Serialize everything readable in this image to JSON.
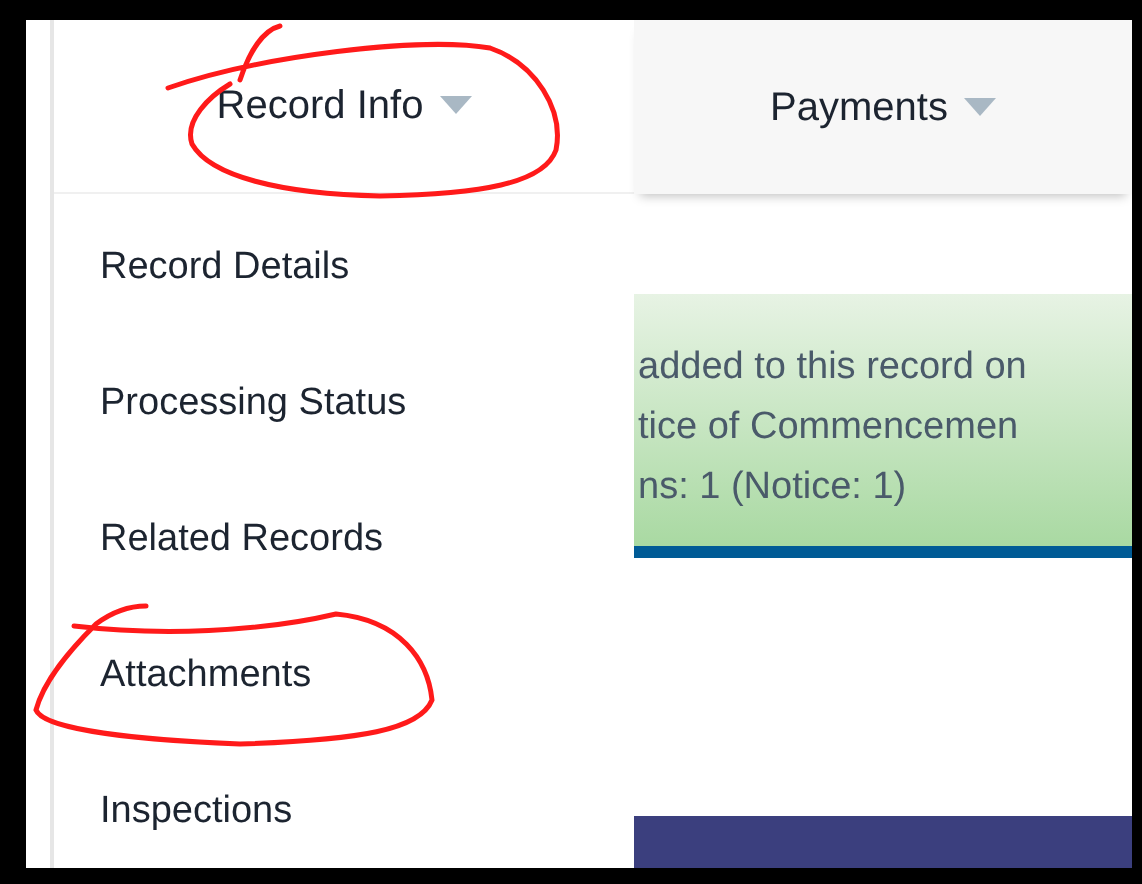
{
  "tabs": [
    {
      "label": "Record Info",
      "selected": true
    },
    {
      "label": "Payments",
      "selected": false
    }
  ],
  "dropdown_menu": {
    "items": [
      {
        "label": "Record Details"
      },
      {
        "label": "Processing Status"
      },
      {
        "label": "Related Records"
      },
      {
        "label": "Attachments"
      },
      {
        "label": "Inspections"
      }
    ]
  },
  "alert": {
    "lines": [
      "added to this record on",
      "tice of Commencemen",
      "ns: 1  (Notice: 1)"
    ]
  }
}
